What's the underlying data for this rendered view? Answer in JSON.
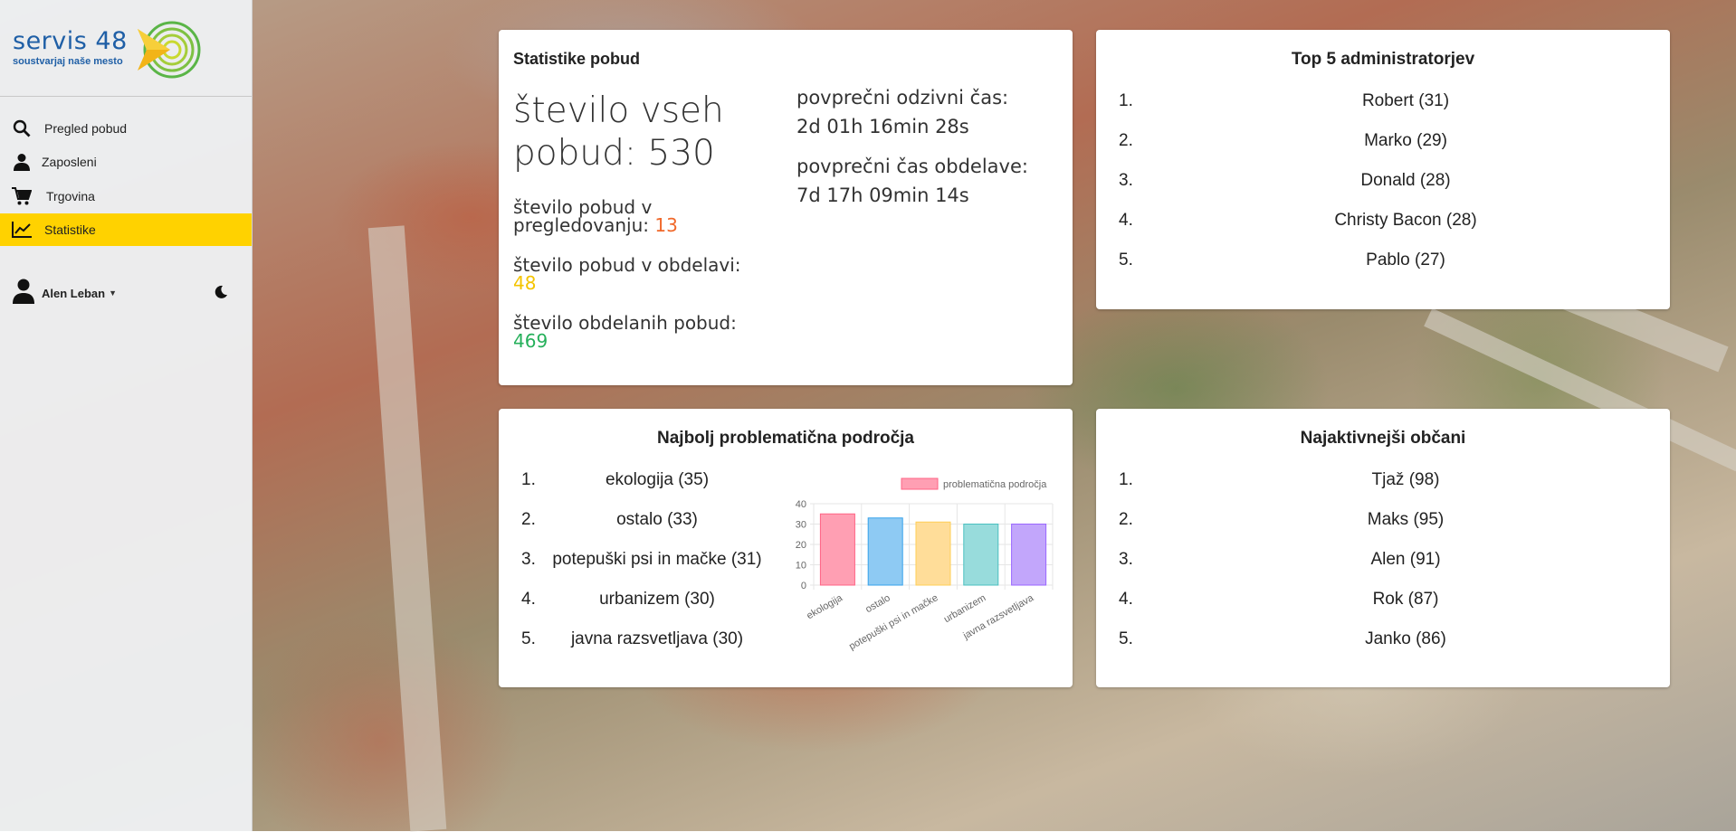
{
  "sidebar": {
    "logo_title": "servis 48",
    "logo_subtitle": "soustvarjaj naše mesto",
    "nav": [
      {
        "label": "Pregled pobud",
        "icon": "search-icon"
      },
      {
        "label": "Zaposleni",
        "icon": "person-icon"
      },
      {
        "label": "Trgovina",
        "icon": "cart-icon"
      },
      {
        "label": "Statistike",
        "icon": "chart-line-icon",
        "active": true
      }
    ],
    "user_name": "Alen Leban",
    "theme_icon": "moon-icon",
    "active_color": "#ffd200"
  },
  "stats_card": {
    "title": "Statistike pobud",
    "total_label": "število vseh pobud: 530",
    "review_label": "število pobud v pregledovanju:",
    "review_value": "13",
    "processing_label": "število pobud v obdelavi:",
    "processing_value": "48",
    "done_label": "število obdelanih pobud:",
    "done_value": "469",
    "avg_response_label": "povprečni odzivni čas:",
    "avg_response_value": "2d 01h 16min 28s",
    "avg_processing_label": "povprečni čas obdelave:",
    "avg_processing_value": "7d 17h 09min 14s",
    "colors": {
      "review": "#f0682a",
      "processing": "#f4c400",
      "done": "#26b05b"
    }
  },
  "top_admins": {
    "title": "Top 5 administratorjev",
    "items": [
      {
        "rank": "1.",
        "name": "Robert (31)"
      },
      {
        "rank": "2.",
        "name": "Marko (29)"
      },
      {
        "rank": "3.",
        "name": "Donald (28)"
      },
      {
        "rank": "4.",
        "name": "Christy Bacon (28)"
      },
      {
        "rank": "5.",
        "name": "Pablo (27)"
      }
    ]
  },
  "problem_areas": {
    "title": "Najbolj problematična področja",
    "items": [
      {
        "rank": "1.",
        "name": "ekologija (35)"
      },
      {
        "rank": "2.",
        "name": "ostalo (33)"
      },
      {
        "rank": "3.",
        "name": "potepuški psi in mačke (31)"
      },
      {
        "rank": "4.",
        "name": "urbanizem (30)"
      },
      {
        "rank": "5.",
        "name": "javna razsvetljava (30)"
      }
    ]
  },
  "active_citizens": {
    "title": "Najaktivnejši občani",
    "items": [
      {
        "rank": "1.",
        "name": "Tjaž (98)"
      },
      {
        "rank": "2.",
        "name": "Maks (95)"
      },
      {
        "rank": "3.",
        "name": "Alen (91)"
      },
      {
        "rank": "4.",
        "name": "Rok (87)"
      },
      {
        "rank": "5.",
        "name": "Janko (86)"
      }
    ]
  },
  "chart_data": {
    "type": "bar",
    "legend": "problematična področja",
    "legend_position": "top",
    "categories": [
      "ekologija",
      "ostalo",
      "potepuški psi in mačke",
      "urbanizem",
      "javna razsvetljava"
    ],
    "values": [
      35,
      33,
      31,
      30,
      30
    ],
    "ylim": [
      0,
      40
    ],
    "yticks": [
      0,
      10,
      20,
      30,
      40
    ],
    "grid": true,
    "fill_colors": [
      "#ff9fb3",
      "#8ecaf3",
      "#ffdd99",
      "#98dcdc",
      "#c2a6fb"
    ],
    "border_colors": [
      "#ff6384",
      "#36a2eb",
      "#ffce56",
      "#4bc0c0",
      "#9966ff"
    ],
    "legend_color": "#ff9fb3"
  }
}
